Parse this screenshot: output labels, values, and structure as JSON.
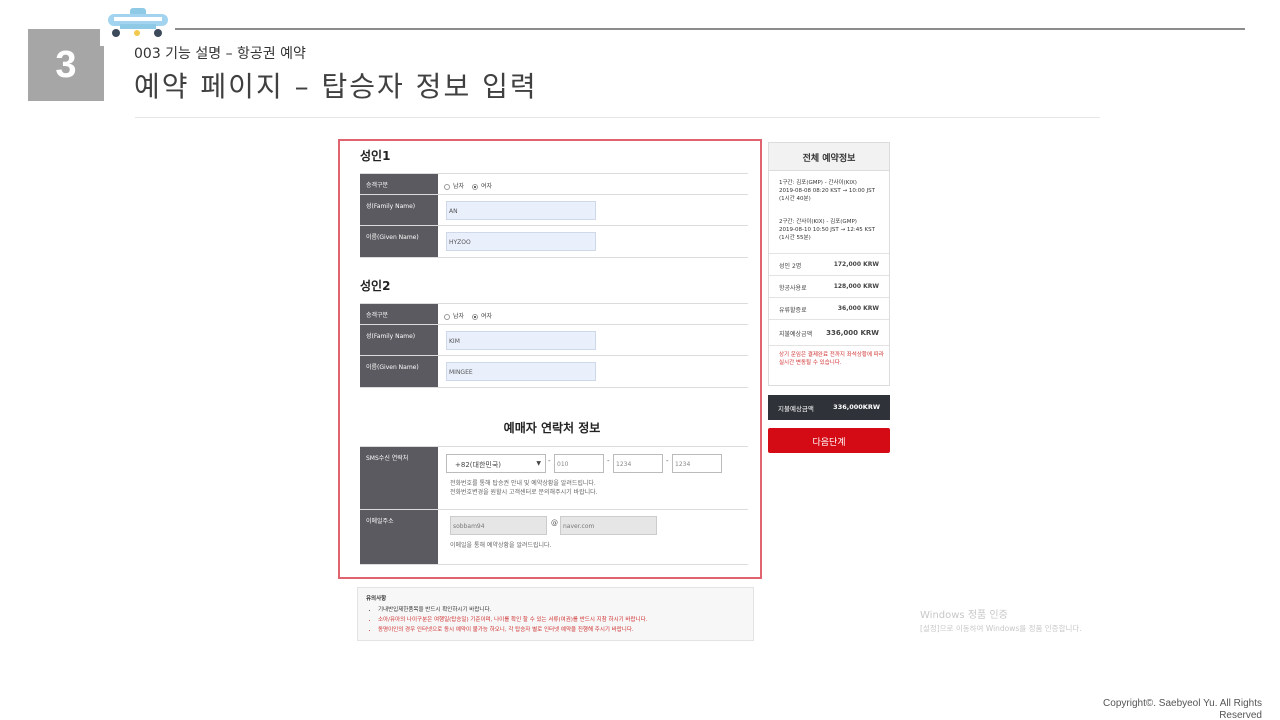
{
  "slide": {
    "number": "3",
    "subtitle": "003 기능 설명 – 항공권 예약",
    "title": "예약 페이지 – 탑승자 정보 입력",
    "copyright": "Copyright©. Saebyeol Yu. All Rights Reserved"
  },
  "adult1": {
    "heading": "성인1",
    "gender_label": "승객구분",
    "male": "남자",
    "female": "여자",
    "family_label": "성(Family Name)",
    "family_value": "AN",
    "given_label": "이름(Given Name)",
    "given_value": "HYZOO"
  },
  "adult2": {
    "heading": "성인2",
    "gender_label": "승객구분",
    "male": "남자",
    "female": "여자",
    "family_label": "성(Family Name)",
    "family_value": "KIM",
    "given_label": "이름(Given Name)",
    "given_value": "MINGEE"
  },
  "contact": {
    "heading": "예매자 연락처 정보",
    "sms_label": "SMS수신 연락처",
    "country_code": "+82(대한민국)",
    "phone1": "010",
    "phone2": "1234",
    "phone3": "1234",
    "sms_note1": "전화번호를 통해 탑승권 안내 및 예약상황을 알려드립니다.",
    "sms_note2": "전화번호변경을 원할시 고객센터로 문의해주시기 바랍니다.",
    "email_label": "이메일주소",
    "email_user": "sobbam94",
    "email_at": "@",
    "email_domain": "naver.com",
    "email_note": "이메일을 통해 예약상황을 알려드립니다."
  },
  "summary": {
    "heading": "전체 예약정보",
    "leg1_line1": "1구간: 김포(GMP) - 간사이(KIX)",
    "leg1_line2": "2019-08-08 08:20 KST → 10:00 JST",
    "leg1_line3": "(1시간 40분)",
    "leg2_line1": "2구간: 간사이(KIX) - 김포(GMP)",
    "leg2_line2": "2019-08-10 10:50 JST → 12:45 KST",
    "leg2_line3": "(1시간 55분)",
    "rows": [
      {
        "label": "성인 2명",
        "value": "172,000 KRW"
      },
      {
        "label": "항공사용료",
        "value": "128,000 KRW"
      },
      {
        "label": "유류할증료",
        "value": "36,000 KRW"
      },
      {
        "label": "지불예상금액",
        "value": "336,000 KRW"
      }
    ],
    "warning": "상기 운임은 결제완료 전까지 좌석상황에 따라 실시간 변동될 수 있습니다.",
    "pay_label": "지불예상금액",
    "pay_value": "336,000KRW",
    "next_button": "다음단계"
  },
  "notice": {
    "title": "유의사항",
    "items": [
      "기내반입제한품목을 반드시 확인하시기 바랍니다.",
      "소아/유아의 나이구분은 여행일(탑승일) 기준이며, 나이를 확인 할 수 있는 서류(여권)를 반드시 지참 하시기 바랍니다.",
      "동명이인의 경우 인터넷으로 동시 예약이 불가능 하오니, 각 탑승자 별로 인터넷 예약을 진행해 주시기 바랍니다."
    ]
  },
  "watermark": {
    "line1": "Windows 정품 인증",
    "line2": "[설정]으로 이동하여 Windows를 정품 인증합니다."
  }
}
